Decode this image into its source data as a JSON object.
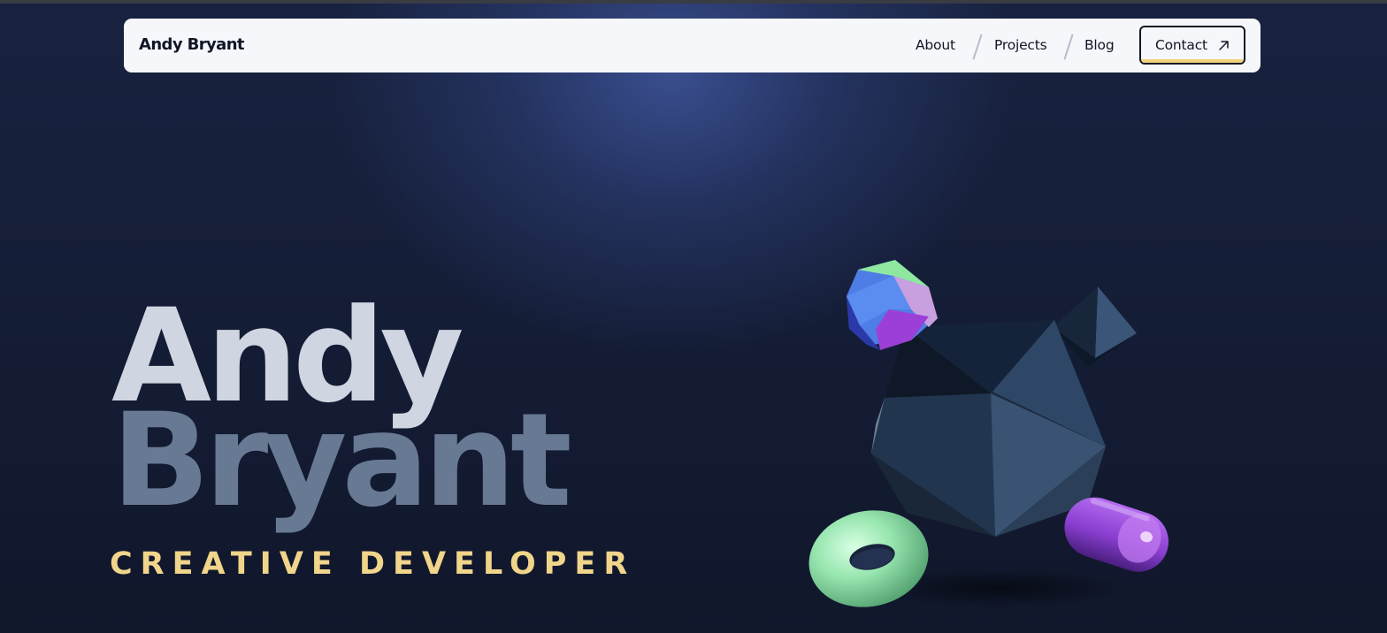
{
  "nav": {
    "brand": "Andy Bryant",
    "links": [
      {
        "label": "About"
      },
      {
        "label": "Projects"
      },
      {
        "label": "Blog"
      }
    ],
    "contact": {
      "label": "Contact",
      "icon": "arrow-up-right-icon"
    }
  },
  "hero": {
    "first_name": "Andy",
    "last_name": "Bryant",
    "role": "CREATIVE DEVELOPER"
  },
  "colors": {
    "background": "#121a2e",
    "glow": "#3a4f92",
    "nav_bg": "#f5f7fb",
    "text_dark": "#111625",
    "accent_yellow": "#f2d27a",
    "first_name": "#d0d5e2",
    "last_name": "#687993",
    "torus_green": "#8ee3a8",
    "capsule_purple": "#9a4fd8",
    "dodecahedron_blue": "#5b8cf0",
    "icosahedron_slate": "#2c4260"
  }
}
